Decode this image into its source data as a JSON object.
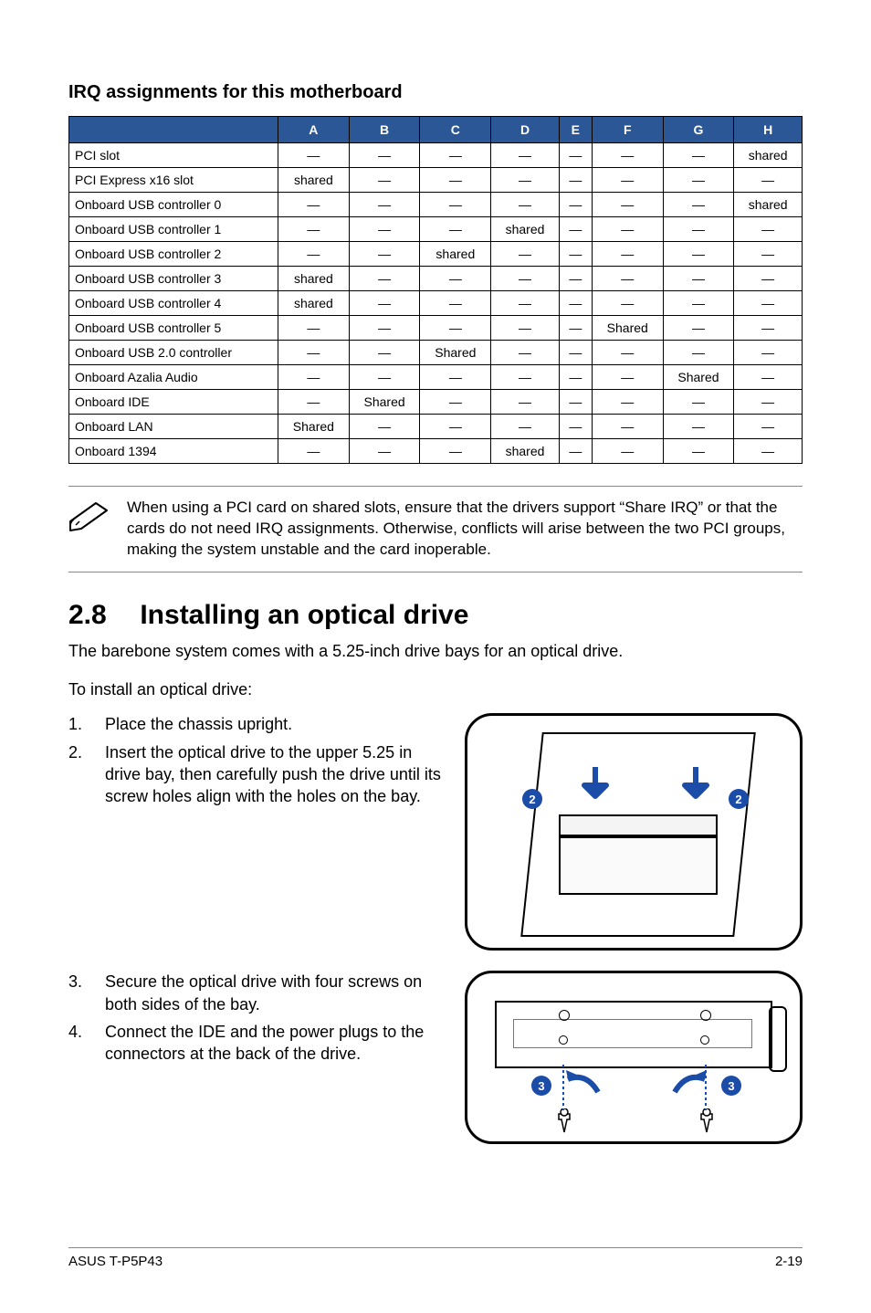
{
  "subheading": "IRQ assignments for this motherboard",
  "table": {
    "columns": [
      "A",
      "B",
      "C",
      "D",
      "E",
      "F",
      "G",
      "H"
    ],
    "rows": [
      {
        "label": "PCI slot",
        "cells": [
          "—",
          "—",
          "—",
          "—",
          "—",
          "—",
          "—",
          "shared"
        ]
      },
      {
        "label": "PCI Express x16 slot",
        "cells": [
          "shared",
          "—",
          "—",
          "—",
          "—",
          "—",
          "—",
          "—"
        ]
      },
      {
        "label": "Onboard USB controller 0",
        "cells": [
          "—",
          "—",
          "—",
          "—",
          "—",
          "—",
          "—",
          "shared"
        ]
      },
      {
        "label": "Onboard USB controller 1",
        "cells": [
          "—",
          "—",
          "—",
          "shared",
          "—",
          "—",
          "—",
          "—"
        ]
      },
      {
        "label": "Onboard USB controller 2",
        "cells": [
          "—",
          "—",
          "shared",
          "—",
          "—",
          "—",
          "—",
          "—"
        ]
      },
      {
        "label": "Onboard USB controller 3",
        "cells": [
          "shared",
          "—",
          "—",
          "—",
          "—",
          "—",
          "—",
          "—"
        ]
      },
      {
        "label": "Onboard USB controller 4",
        "cells": [
          "shared",
          "—",
          "—",
          "—",
          "—",
          "—",
          "—",
          "—"
        ]
      },
      {
        "label": "Onboard USB controller 5",
        "cells": [
          "—",
          "—",
          "—",
          "—",
          "—",
          "Shared",
          "—",
          "—"
        ]
      },
      {
        "label": "Onboard USB 2.0 controller",
        "cells": [
          "—",
          "—",
          "Shared",
          "—",
          "—",
          "—",
          "—",
          "—"
        ]
      },
      {
        "label": "Onboard Azalia Audio",
        "cells": [
          "—",
          "—",
          "—",
          "—",
          "—",
          "—",
          "Shared",
          "—"
        ]
      },
      {
        "label": "Onboard IDE",
        "cells": [
          "—",
          "Shared",
          "—",
          "—",
          "—",
          "—",
          "—",
          "—"
        ]
      },
      {
        "label": "Onboard LAN",
        "cells": [
          "Shared",
          "—",
          "—",
          "—",
          "—",
          "—",
          "—",
          "—"
        ]
      },
      {
        "label": "Onboard 1394",
        "cells": [
          "—",
          "—",
          "—",
          "shared",
          "—",
          "—",
          "—",
          "—"
        ]
      }
    ]
  },
  "note_text": "When using a PCI card on shared slots, ensure that the drivers support “Share IRQ” or that the cards do not need IRQ assignments. Otherwise, conflicts will arise between the two PCI groups, making the system unstable and the card inoperable.",
  "section": {
    "number": "2.8",
    "title": "Installing an optical drive"
  },
  "intro1": "The barebone system comes with a 5.25-inch drive bays for an optical drive.",
  "intro2": "To install an optical drive:",
  "steps": {
    "s1": "Place the chassis upright.",
    "s2": "Insert the optical drive to the upper 5.25 in drive bay, then carefully push the drive until its screw holes align with the holes on the bay.",
    "s3": "Secure the optical drive with four screws on both sides of the bay.",
    "s4": "Connect the IDE and the power plugs to the connectors at the back of the drive."
  },
  "callouts": {
    "c2": "2",
    "c3": "3"
  },
  "footer": {
    "left": "ASUS T-P5P43",
    "right": "2-19"
  }
}
